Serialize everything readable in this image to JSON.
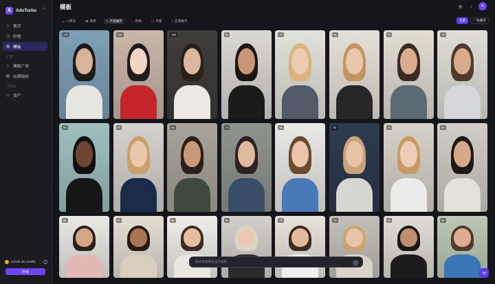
{
  "app": {
    "name": "AdsTurbo",
    "logo_letter": "A"
  },
  "header": {
    "title": "模板",
    "avatar_letter": "A"
  },
  "sidebar": {
    "items": [
      {
        "label": "首页",
        "icon": "home-icon",
        "glyph": "⌂",
        "active": false
      },
      {
        "label": "历程",
        "icon": "history-icon",
        "glyph": "◷",
        "active": false
      },
      {
        "label": "模板",
        "icon": "template-icon",
        "glyph": "▦",
        "active": true
      }
    ],
    "section_ads": "广告",
    "ad_items": [
      {
        "label": "爆款广告",
        "icon": "fire-icon",
        "glyph": "♨"
      },
      {
        "label": "社媒指标",
        "icon": "chart-icon",
        "glyph": "▤"
      }
    ],
    "section_workspace": "工作台",
    "workspace_items": [
      {
        "label": "资产",
        "icon": "folder-icon",
        "glyph": "▭"
      }
    ],
    "credits": "12100.25 credits",
    "upgrade": "升级"
  },
  "tabs": [
    {
      "label": "AI演员",
      "glyph": "☺",
      "active": false
    },
    {
      "label": "场景",
      "glyph": "▣",
      "active": false
    },
    {
      "label": "产品展示",
      "glyph": "✦",
      "active": true
    },
    {
      "label": "时尚",
      "glyph": "◌",
      "active": false
    },
    {
      "label": "开箱",
      "glyph": "▢",
      "active": false
    },
    {
      "label": "应用展示",
      "glyph": "▯",
      "active": false
    }
  ],
  "actions": {
    "primary": "全部",
    "secondary": "收藏夹"
  },
  "prompt": {
    "placeholder": "描述你想要生成的视频..."
  },
  "colors": {
    "accent": "#5b3ee6",
    "active_nav": "#2d2760"
  },
  "cards": [
    {
      "duration": "17s",
      "wall": "#7fa0b6",
      "skin": "#d8b39a",
      "hair": "#1e1a18",
      "top": "#e7e5e0"
    },
    {
      "duration": "12s",
      "wall": "#c9b7ab",
      "skin": "#f1d4c4",
      "hair": "#211b1b",
      "top": "#c4262c"
    },
    {
      "duration": "16s",
      "wall": "#3e3d3c",
      "skin": "#dcb69d",
      "hair": "#2a201b",
      "top": "#ece9e4"
    },
    {
      "duration": "6s",
      "wall": "#d9d8d3",
      "skin": "#c89576",
      "hair": "#1c1715",
      "top": "#1b1b1b"
    },
    {
      "duration": "7s",
      "wall": "#e4e2dc",
      "skin": "#edcbb0",
      "hair": "#d7b57c",
      "top": "#525a68"
    },
    {
      "duration": "6s",
      "wall": "#e6e1d8",
      "skin": "#eac6ac",
      "hair": "#c09561",
      "top": "#262626"
    },
    {
      "duration": "7s",
      "wall": "#e2ddd3",
      "skin": "#d9ab8f",
      "hair": "#3a2a20",
      "top": "#5b6a72"
    },
    {
      "duration": "7s",
      "wall": "#e0ded7",
      "skin": "#d9ab8e",
      "hair": "#4c3a2c",
      "top": "#d6d7da"
    },
    {
      "duration": "8s",
      "wall": "#9fc0bf",
      "skin": "#6d4632",
      "hair": "#111111",
      "top": "#161616"
    },
    {
      "duration": "7s",
      "wall": "#d6d3ce",
      "skin": "#ecc7ad",
      "hair": "#c7a06e",
      "top": "#1c2b4a"
    },
    {
      "duration": "8s",
      "wall": "#a8a49c",
      "skin": "#c9987a",
      "hair": "#2b1f18",
      "top": "#3f4a3c"
    },
    {
      "duration": "7s",
      "wall": "#8f948f",
      "skin": "#e1b99f",
      "hair": "#2a2220",
      "top": "#3a4d68"
    },
    {
      "duration": "8s",
      "wall": "#ebe9e6",
      "skin": "#ebc6ac",
      "hair": "#6a4a2f",
      "top": "#4a79b8"
    },
    {
      "duration": "8s",
      "wall": "#2e3a4e",
      "skin": "#e7c3a8",
      "hair": "#c8a27a",
      "top": "#d8d6d2"
    },
    {
      "duration": "7s",
      "wall": "#d7d3cb",
      "skin": "#edcdb6",
      "hair": "#c69a62",
      "top": "#ececea"
    },
    {
      "duration": "8s",
      "wall": "#d2cdc6",
      "skin": "#d8a88a",
      "hair": "#1d1715",
      "top": "#e4e0da"
    },
    {
      "duration": "9s",
      "wall": "#ebe9e6",
      "skin": "#d6a685",
      "hair": "#2a201c",
      "top": "#e2b9b6"
    },
    {
      "duration": "9s",
      "wall": "#e4ded4",
      "skin": "#a97655",
      "hair": "#241a13",
      "top": "#d9cfbf"
    },
    {
      "duration": "6s",
      "wall": "#f0eeea",
      "skin": "#e5bd9f",
      "hair": "#3b2b22",
      "top": "#e9e6e0"
    },
    {
      "duration": "6s",
      "wall": "#d3d0cb",
      "skin": "#e9c9b4",
      "hair": "#dad3c7",
      "top": "#2b2b2b"
    },
    {
      "duration": "7s",
      "wall": "#e8e4dc",
      "skin": "#e4b99c",
      "hair": "#3a2a20",
      "top": "#efefef"
    },
    {
      "duration": "7s",
      "wall": "#c3c0b9",
      "skin": "#e9c4a9",
      "hair": "#c9a470",
      "top": "#d8d2c8"
    },
    {
      "duration": "6s",
      "wall": "#e1ddd6",
      "skin": "#bf8e6f",
      "hair": "#1b1613",
      "top": "#1c1c1c"
    },
    {
      "duration": "6s",
      "wall": "#bfc8b5",
      "skin": "#e2ad92",
      "hair": "#4d3a2e",
      "top": "#3c74b8"
    }
  ]
}
